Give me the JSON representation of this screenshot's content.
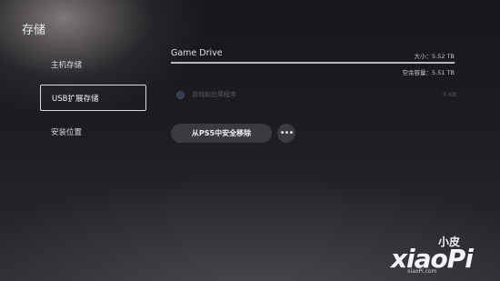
{
  "page": {
    "title": "存储"
  },
  "nav": {
    "items": [
      {
        "label": "主机存储",
        "selected": false
      },
      {
        "label": "USB扩展存储",
        "selected": true
      },
      {
        "label": "安装位置",
        "selected": false
      }
    ]
  },
  "drive": {
    "name": "Game Drive",
    "size_text": "大小：5.52 TB",
    "free_text": "空余容量：5.51 TB",
    "used_fraction": 0.998
  },
  "disabled_option": {
    "label": "游戏和应用程序",
    "value": "0 KB"
  },
  "actions": {
    "remove_label": "从PS5中安全移除",
    "more_label": "•••"
  },
  "watermark": {
    "cn": "小皮",
    "latin": "xiaoPi",
    "domain": "xiaoPi.com"
  },
  "colors": {
    "selected_border": "#d9d9dd",
    "button_bg": "#3a3a40",
    "radio_accent": "#5b7fb5"
  }
}
